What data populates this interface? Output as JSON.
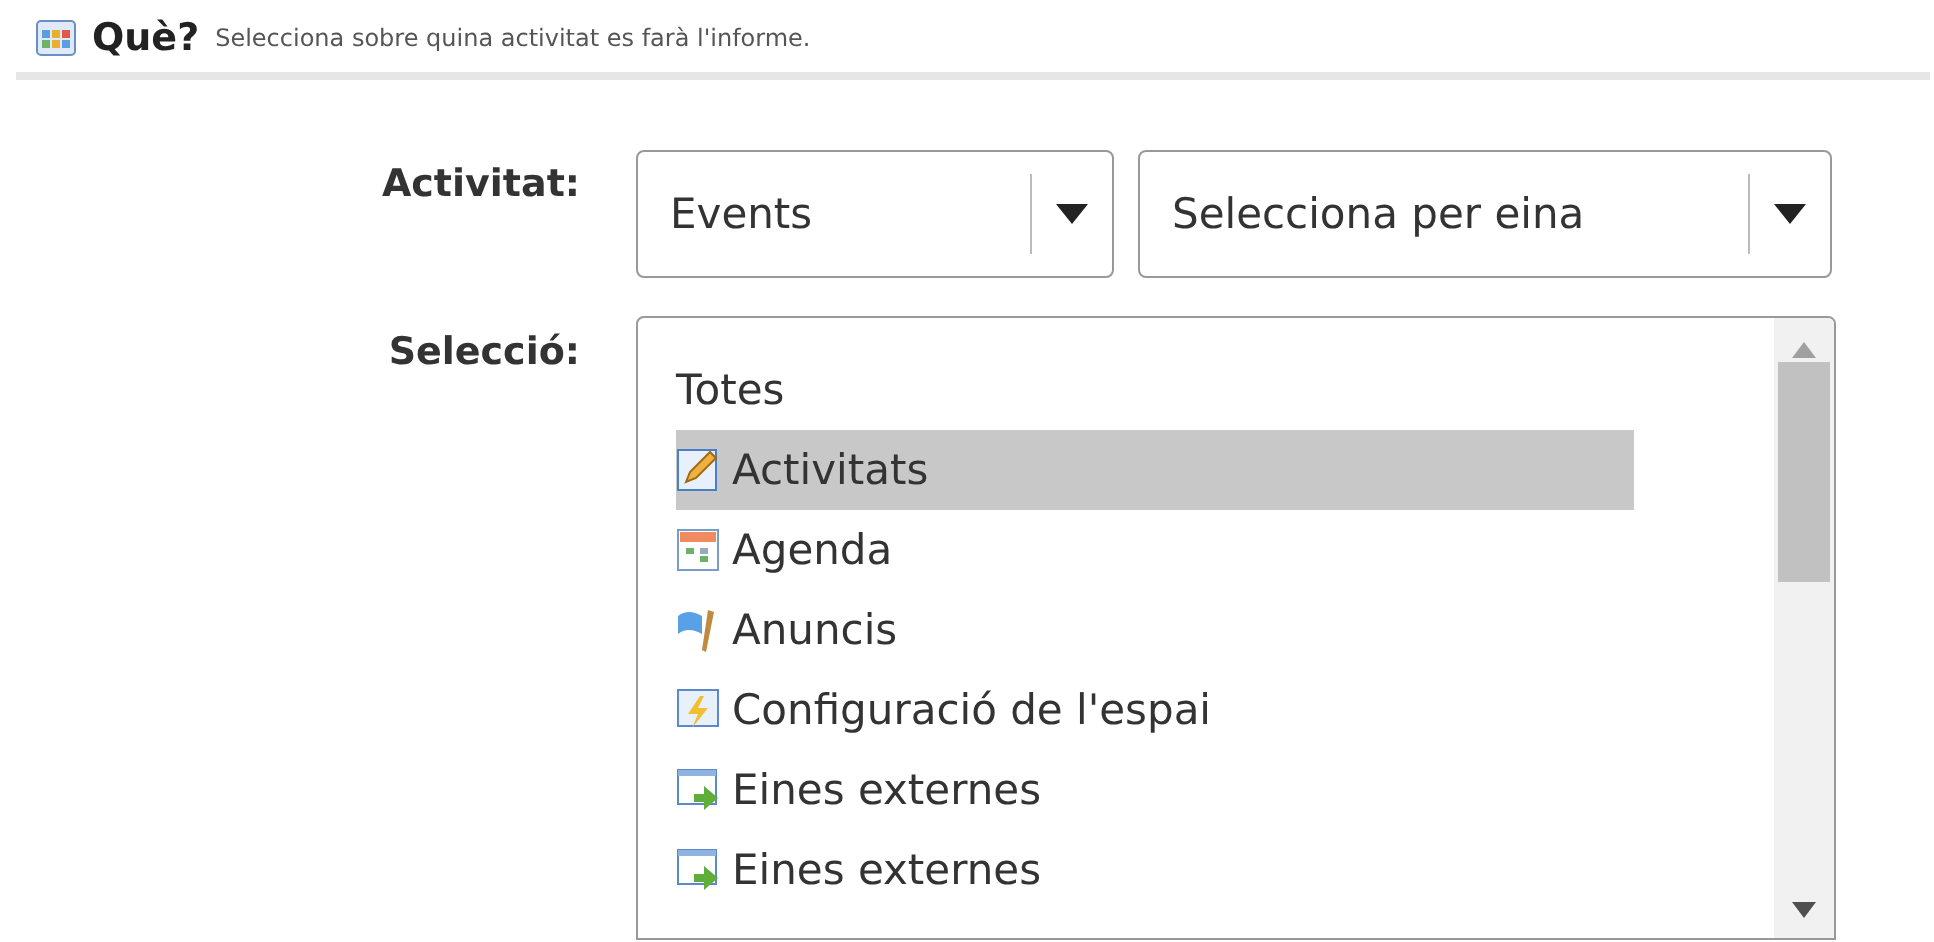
{
  "header": {
    "title": "Què?",
    "subtitle": "Selecciona sobre quina activitat es farà l'informe."
  },
  "activity": {
    "label": "Activitat:",
    "dropdowns": [
      {
        "value": "Events"
      },
      {
        "value": "Selecciona per eina"
      }
    ]
  },
  "selection": {
    "label": "Selecció:",
    "items": [
      {
        "label": "Totes",
        "kind": "plain",
        "selected": false
      },
      {
        "label": "Activitats",
        "kind": "pencil",
        "selected": true
      },
      {
        "label": "Agenda",
        "kind": "calendar",
        "selected": false
      },
      {
        "label": "Anuncis",
        "kind": "flag",
        "selected": false
      },
      {
        "label": "Configuració de l'espai",
        "kind": "lightning",
        "selected": false
      },
      {
        "label": "Eines externes",
        "kind": "arrow",
        "selected": false
      },
      {
        "label": "Eines externes",
        "kind": "arrow",
        "selected": false
      }
    ]
  }
}
